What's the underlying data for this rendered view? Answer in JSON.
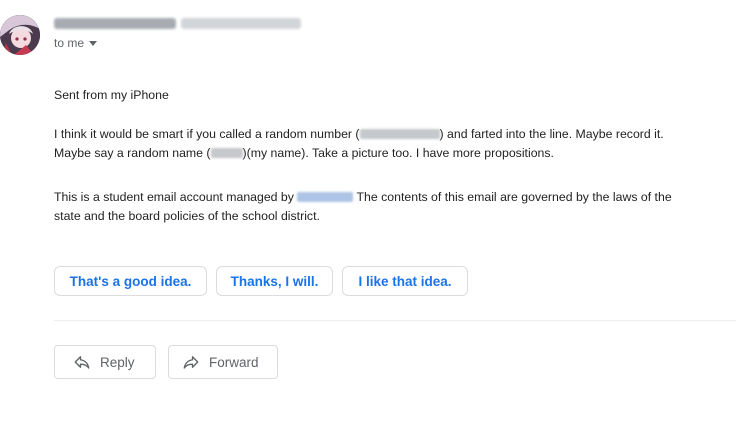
{
  "message": {
    "recipient_label": "to me",
    "body": {
      "signature": "Sent from my iPhone",
      "line1_a": "I think it would be smart if you called a random number (",
      "line1_b": ") and farted into the line. Maybe record it.",
      "line2_a": "Maybe say a random name (",
      "line2_b": ")(my name). Take a picture too. I have more propositions.",
      "footer_a": "This is a student email account managed by ",
      "footer_b": " The contents of this email are governed by the laws of the",
      "footer_c": "state and the board policies of the school district."
    }
  },
  "smart_replies": [
    "That's a good idea.",
    "Thanks, I will.",
    "I like that idea."
  ],
  "actions": {
    "reply_label": "Reply",
    "forward_label": "Forward"
  },
  "colors": {
    "accent": "#1a73e8",
    "muted": "#5f6368",
    "border": "#dadce0"
  },
  "icons": {
    "reply": "reply-arrow-icon",
    "forward": "forward-arrow-icon",
    "dropdown": "caret-down-icon"
  }
}
